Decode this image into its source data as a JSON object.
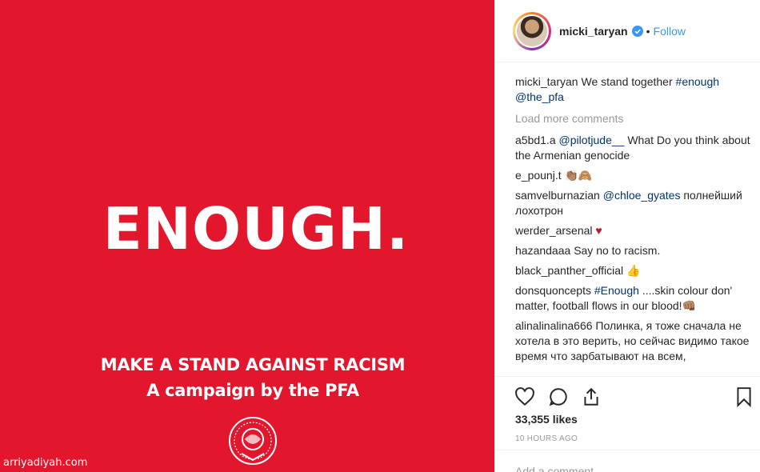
{
  "media": {
    "headline": "ENOUGH.",
    "tagline_line1": "MAKE A STAND AGAINST RACISM",
    "tagline_line2": "A campaign by the PFA",
    "watermark": "arriyadiyah.com",
    "background_color": "#e2162c"
  },
  "header": {
    "username": "micki_taryan",
    "separator": "•",
    "follow_label": "Follow"
  },
  "caption": {
    "user": "micki_taryan",
    "text": "We stand together",
    "hashtag": "#enough",
    "mention": "@the_pfa"
  },
  "load_more_label": "Load more comments",
  "comments": [
    {
      "user": "a5bd1.a",
      "mention": "@pilotjude__",
      "text": "What Do you think about the Armenian genocide"
    },
    {
      "user": "e_pounj.t",
      "text": "👏🏽🙈"
    },
    {
      "user": "samvelburnazian",
      "mention": "@chloe_gyates",
      "text": "полнейший лохотрон"
    },
    {
      "user": "werder_arsenal",
      "text": "♥"
    },
    {
      "user": "hazandaaa",
      "text": "Say no to racism."
    },
    {
      "user": "black_panther_official",
      "text": "👍"
    },
    {
      "user": "donsquoncepts",
      "mention": "#Enough",
      "text": "....skin colour don' matter, football flows in our blood!👊🏽"
    },
    {
      "user": "alinalinalina666",
      "text": "Полинка, я тоже сначала не хотела в это верить, но сейчас видимо такое время что зарбатывают на всем, попробовала получилось, вчера"
    }
  ],
  "stats": {
    "likes": "33,355 likes",
    "time": "10 HOURS AGO"
  },
  "add_comment_placeholder": "Add a comment..."
}
